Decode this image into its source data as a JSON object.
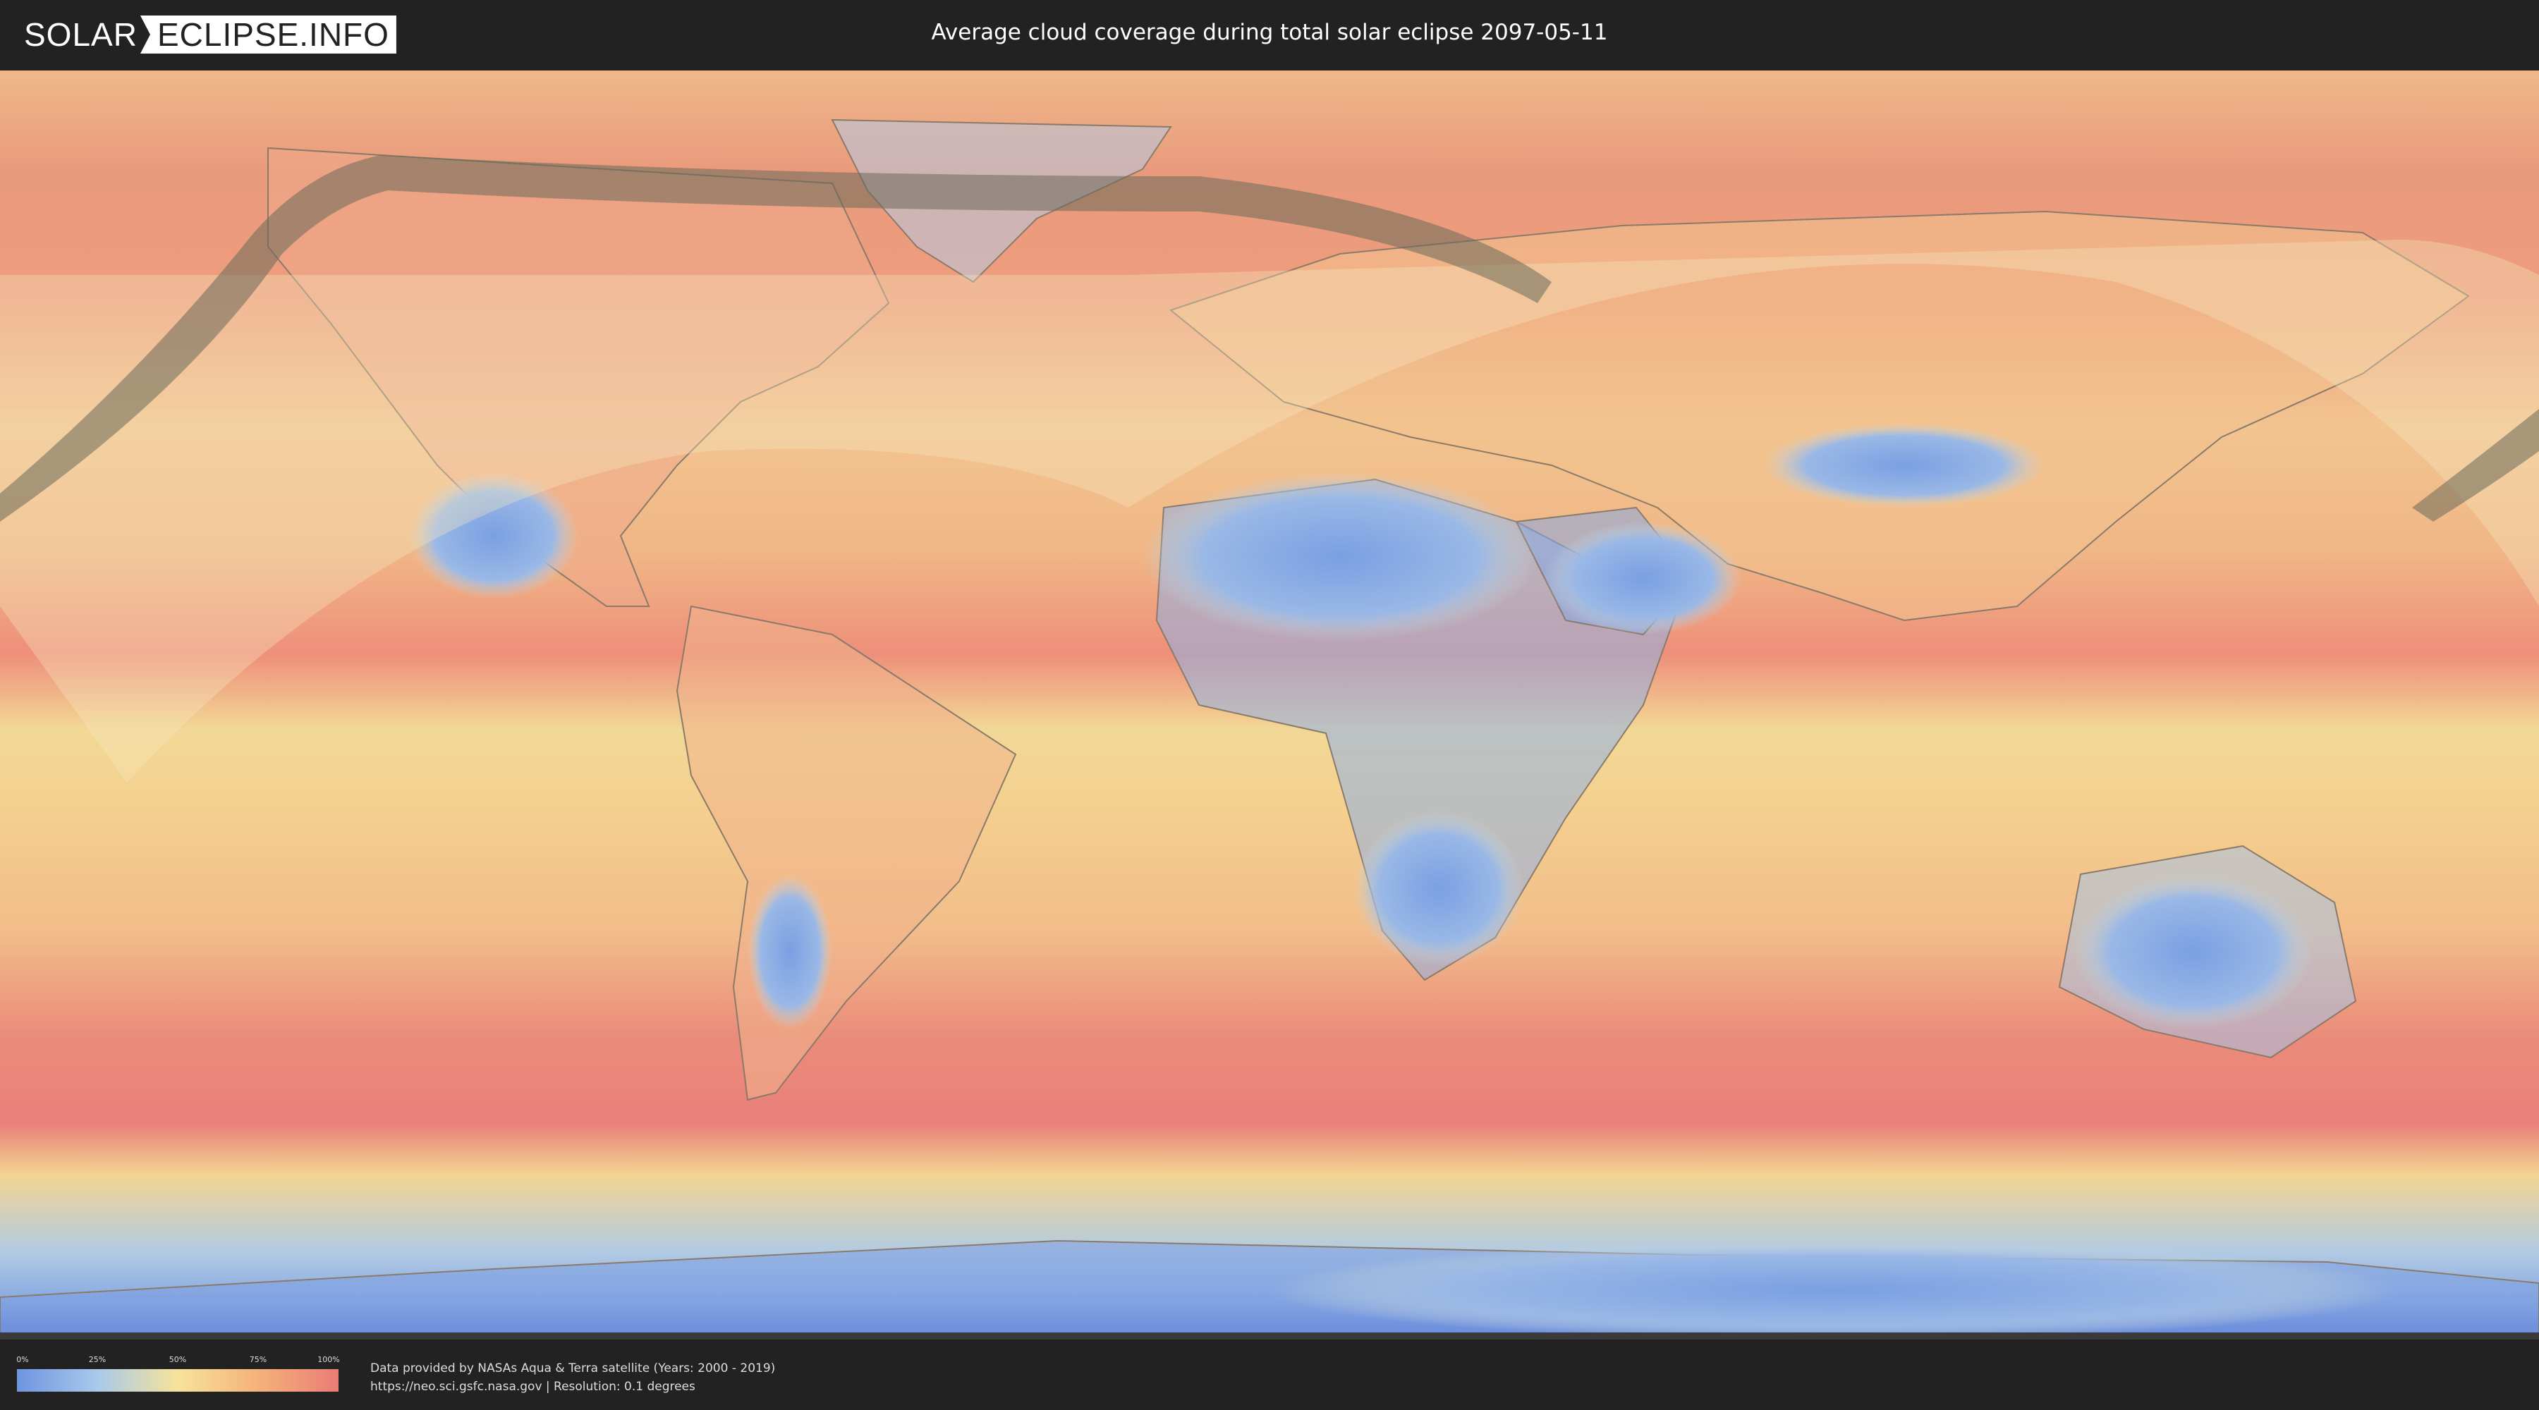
{
  "header": {
    "logo_left": "SOLAR",
    "logo_right": "ECLIPSE.INFO",
    "title": "Average cloud coverage during total solar eclipse 2097-05-11"
  },
  "legend": {
    "ticks": [
      "0%",
      "25%",
      "50%",
      "75%",
      "100%"
    ],
    "colors": [
      "#6f95e0",
      "#a9c9ea",
      "#f6e39b",
      "#f4b27a",
      "#ea7c76"
    ]
  },
  "credits": {
    "line1": "Data provided by NASAs Aqua & Terra satellite (Years: 2000 - 2019)",
    "line2": "https://neo.sci.gsfc.nasa.gov | Resolution: 0.1 degrees"
  },
  "map": {
    "ocean_color": "#eea07c",
    "land_outline_color": "#8a7a6a",
    "eclipse_path_color": "#6a6a5a"
  }
}
